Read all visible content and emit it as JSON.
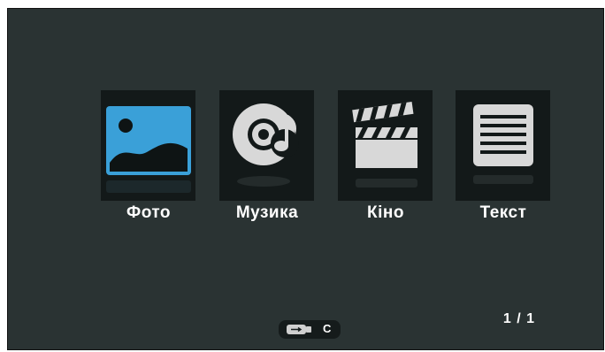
{
  "menu": {
    "items": [
      {
        "label": "Фото",
        "icon": "photo-icon"
      },
      {
        "label": "Музика",
        "icon": "music-disc-icon"
      },
      {
        "label": "Кіно",
        "icon": "clapperboard-icon"
      },
      {
        "label": "Текст",
        "icon": "text-document-icon"
      }
    ]
  },
  "pager": {
    "text": "1 / 1"
  },
  "device": {
    "icon": "usb-drive-icon",
    "letter": "C"
  },
  "colors": {
    "background": "#2a3333",
    "tile": "#131919",
    "photo_accent": "#3aa0d8",
    "icon_gray": "#d8d8d8"
  }
}
